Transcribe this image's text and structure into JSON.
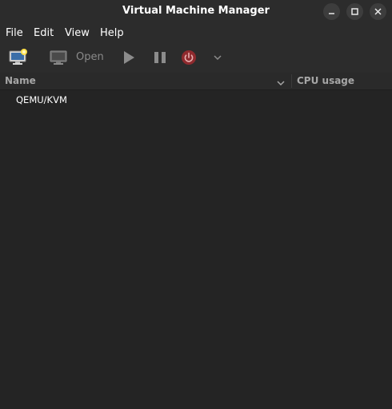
{
  "window": {
    "title": "Virtual Machine Manager"
  },
  "menu": [
    "File",
    "Edit",
    "View",
    "Help"
  ],
  "toolbar": {
    "open_label": "Open"
  },
  "columns": {
    "name": "Name",
    "cpu": "CPU usage"
  },
  "connections": [
    {
      "name": "QEMU/KVM"
    }
  ],
  "colors": {
    "power_accent": "#c33b3b",
    "background": "#242424",
    "chrome": "#2c2c2c"
  }
}
